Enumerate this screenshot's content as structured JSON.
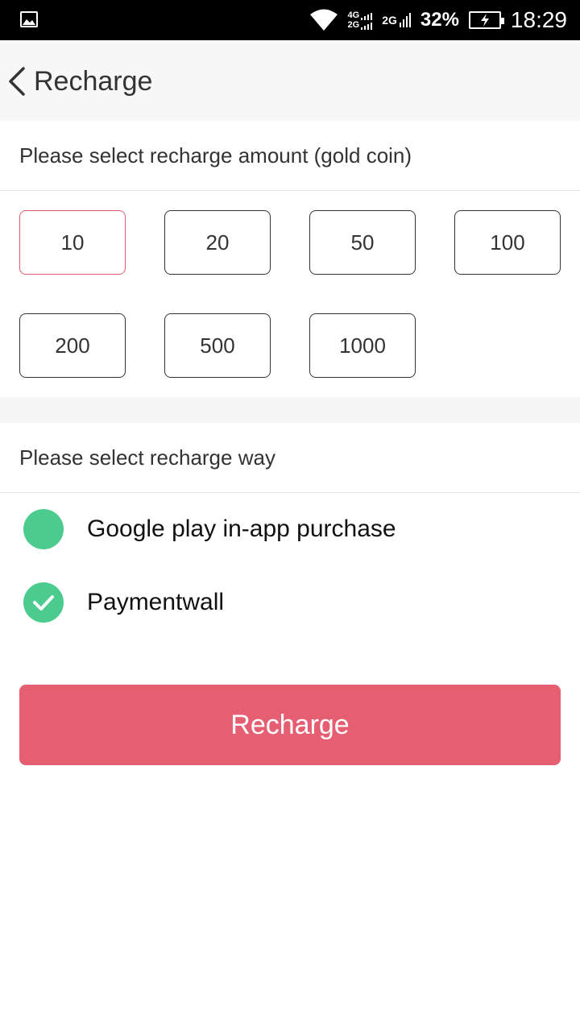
{
  "status_bar": {
    "network_top": "4G",
    "network_bottom": "2G",
    "network_2g": "2G",
    "battery_percent": "32%",
    "time": "18:29"
  },
  "header": {
    "title": "Recharge",
    "back_icon": "chevron-left-icon"
  },
  "amount_section": {
    "label": "Please select recharge amount (gold coin)",
    "selected": "10",
    "options": [
      "10",
      "20",
      "50",
      "100",
      "200",
      "500",
      "1000"
    ],
    "selected_border_color": "#e45a70"
  },
  "way_section": {
    "label": "Please select recharge way",
    "options": [
      {
        "label": "Google play in-app purchase",
        "checked": false
      },
      {
        "label": "Paymentwall",
        "checked": true
      }
    ],
    "radio_color": "#4ccb8e"
  },
  "recharge_button": {
    "label": "Recharge",
    "color": "#e55e72"
  }
}
